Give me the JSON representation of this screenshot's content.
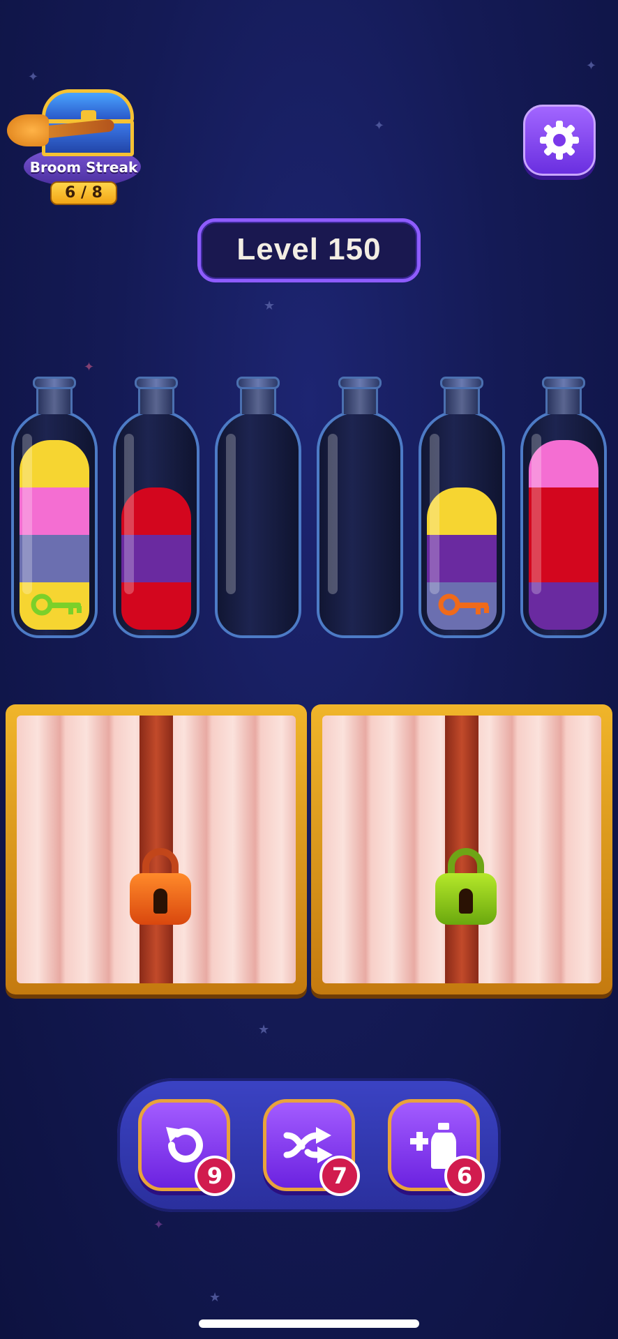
{
  "streak": {
    "label": "Broom Streak",
    "count": "6 / 8"
  },
  "level": {
    "title": "Level 150"
  },
  "settings": {
    "icon": "gear-icon"
  },
  "bottles": [
    {
      "layers": [
        "#f6d531",
        "#f46ed2",
        "#6b6fb0",
        "#f6d531"
      ],
      "key": "green"
    },
    {
      "layers": [
        "#d3061e",
        "#6a2aa0",
        "#d3061e"
      ],
      "key": null
    },
    {
      "layers": [],
      "key": null
    },
    {
      "layers": [],
      "key": null
    },
    {
      "layers": [
        "#f6d531",
        "#6a2aa0",
        "#6b6fb0"
      ],
      "key": "orange"
    },
    {
      "layers": [
        "#f46ed2",
        "#d3061e",
        "#d3061e",
        "#6a2aa0"
      ],
      "key": null
    }
  ],
  "locks": [
    {
      "color": "orange"
    },
    {
      "color": "green"
    }
  ],
  "tools": [
    {
      "name": "undo",
      "icon": "undo-icon",
      "count": "9"
    },
    {
      "name": "shuffle",
      "icon": "shuffle-icon",
      "count": "7"
    },
    {
      "name": "add-bottle",
      "icon": "add-bottle-icon",
      "count": "6"
    }
  ],
  "colors": {
    "background": "#141a55",
    "accent": "#8e5cff",
    "badge": "#d11b4e",
    "gold": "#f0b52a"
  }
}
